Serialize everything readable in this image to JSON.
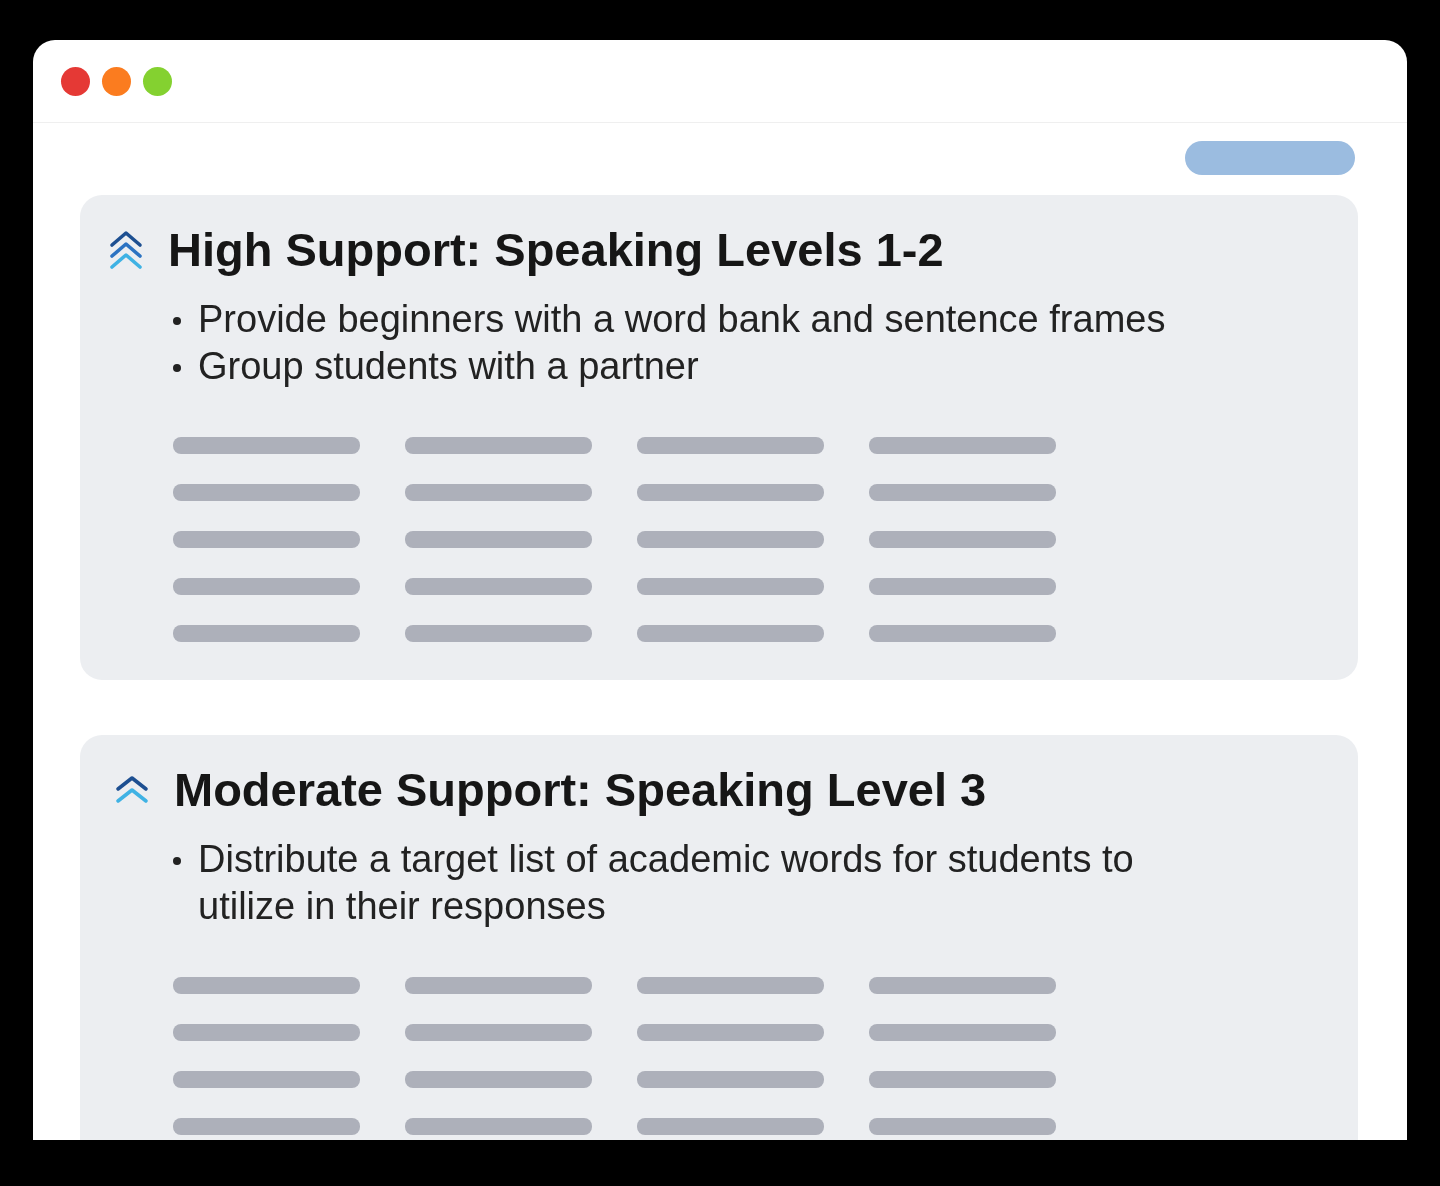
{
  "sections": [
    {
      "kind": "high",
      "title": "High Support: Speaking Levels 1-2",
      "bullets": [
        "Provide beginners with a word bank and sentence frames",
        "Group students with a partner"
      ]
    },
    {
      "kind": "moderate",
      "title": "Moderate Support: Speaking Level 3",
      "bullets": [
        "Distribute a target list of academic words for students to utilize in their responses"
      ]
    }
  ]
}
